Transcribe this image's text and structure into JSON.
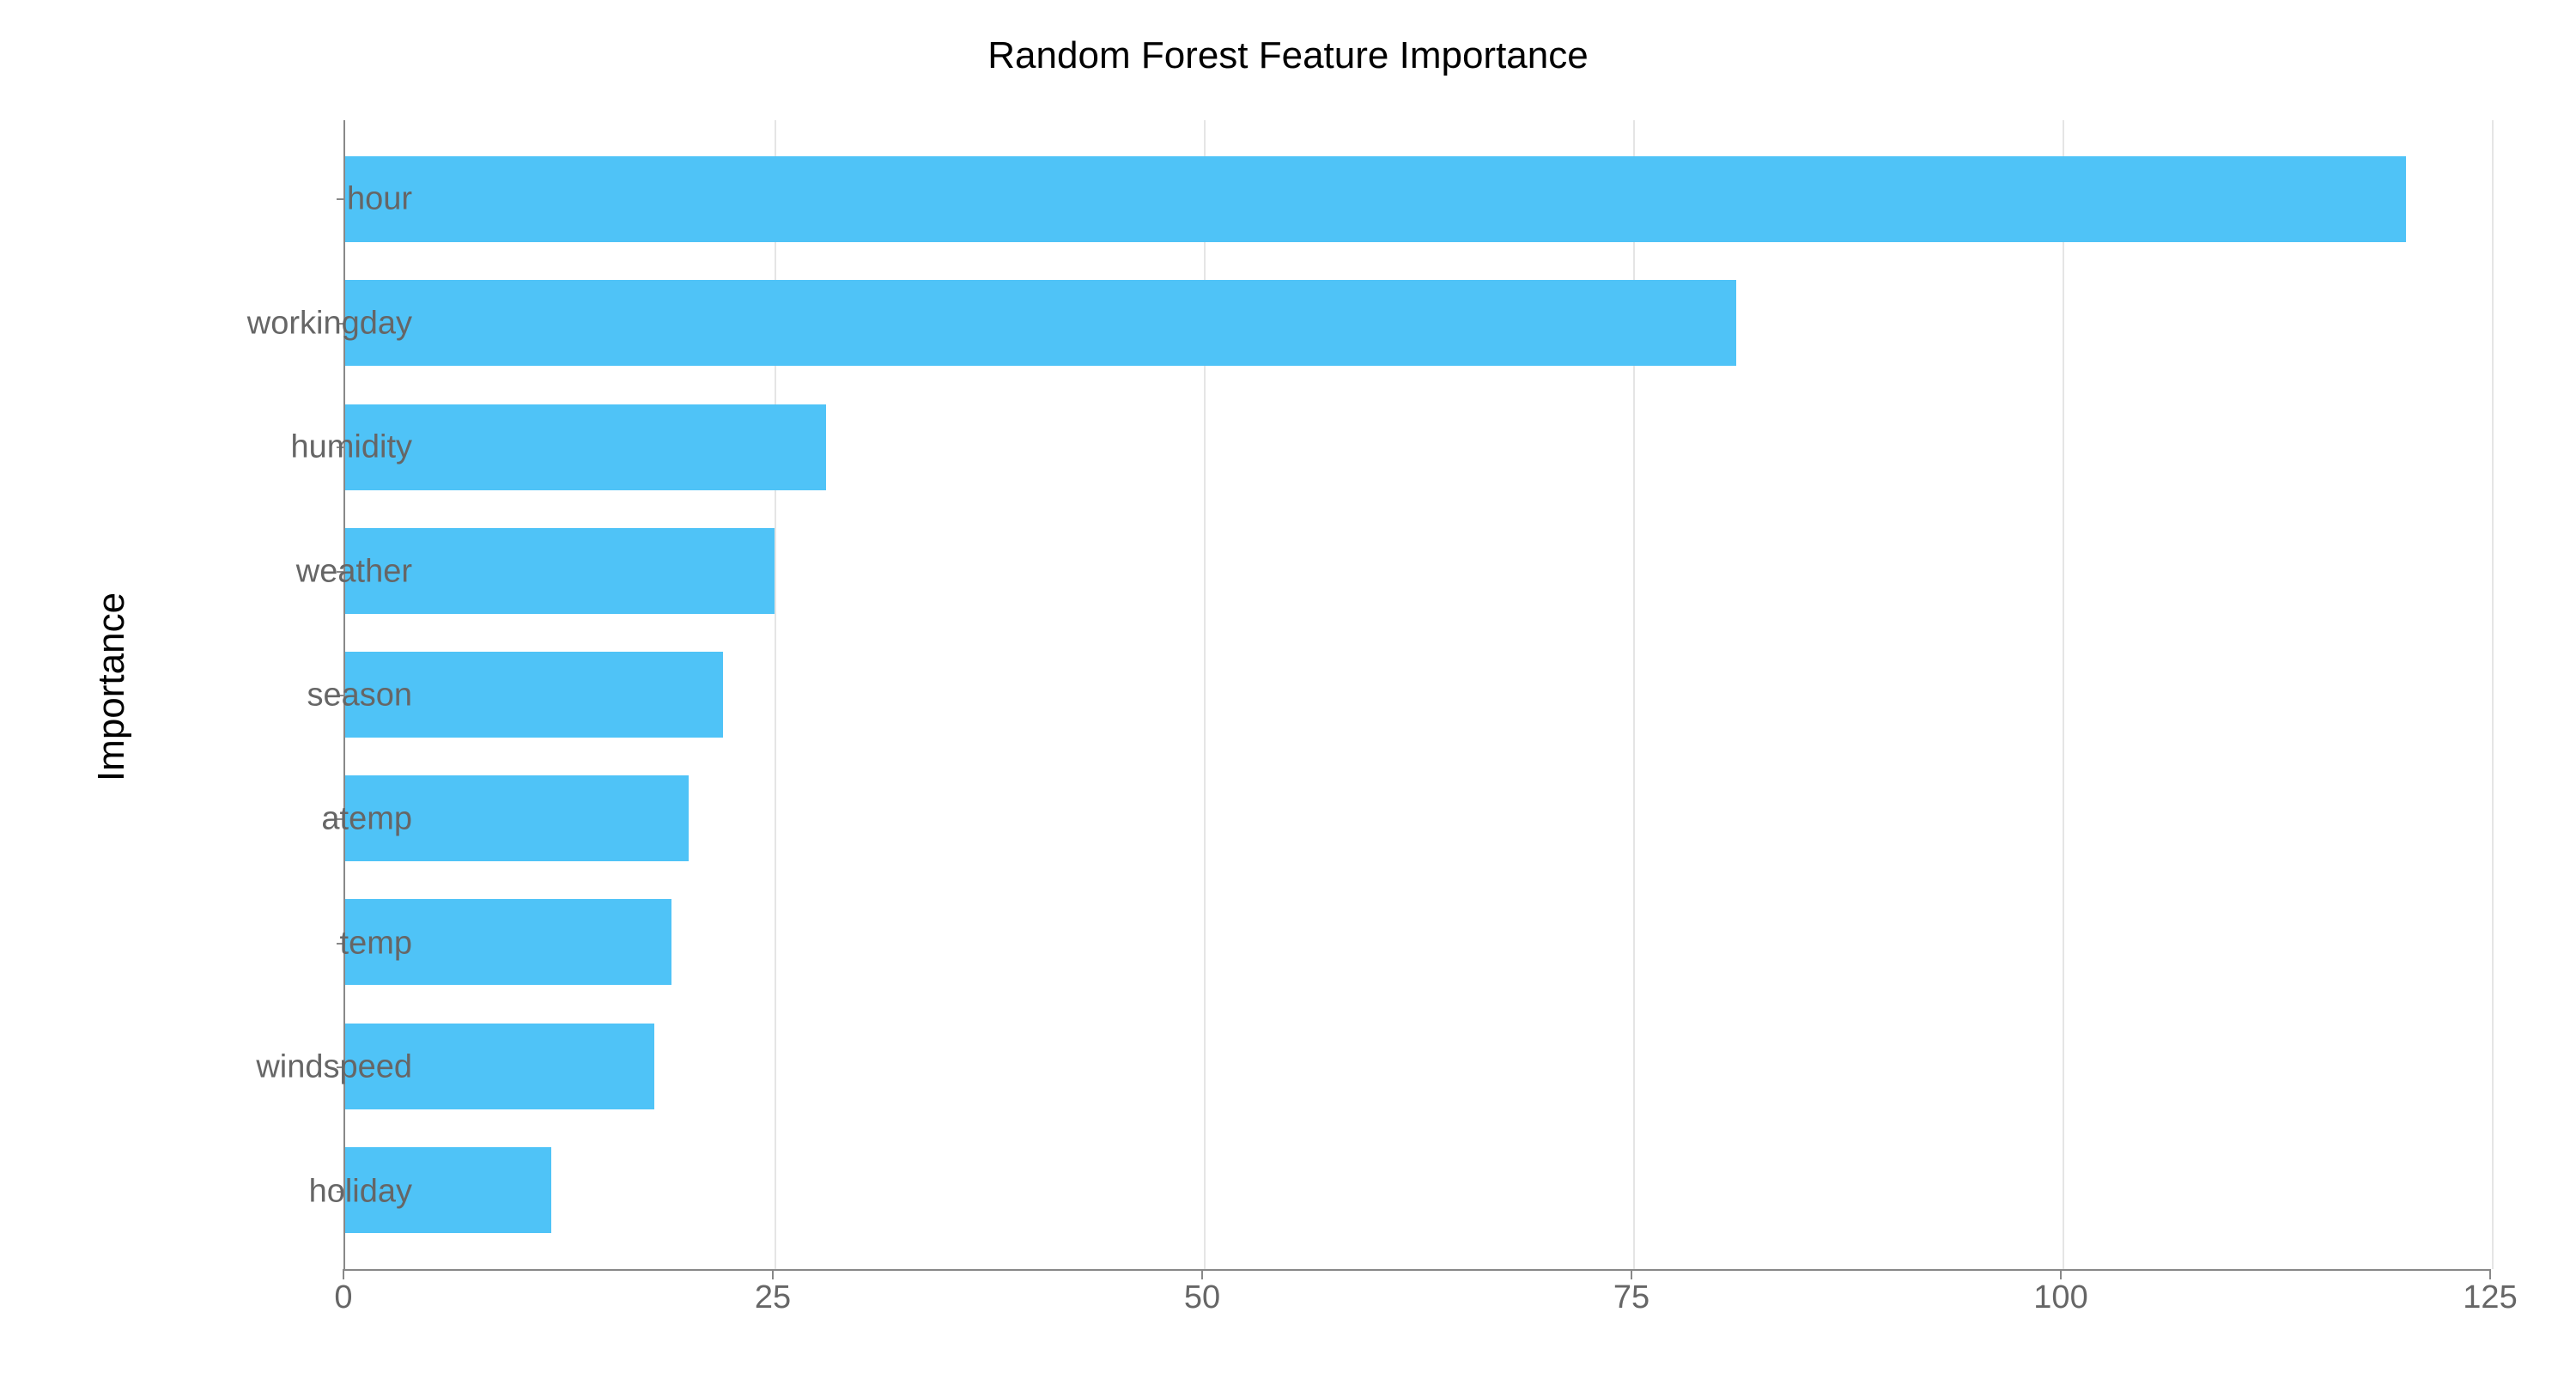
{
  "chart_data": {
    "type": "bar",
    "orientation": "horizontal",
    "title": "Random Forest Feature Importance",
    "ylabel": "Importance",
    "xlabel": "",
    "xlim": [
      0,
      125
    ],
    "xticks": [
      0,
      25,
      50,
      75,
      100,
      125
    ],
    "categories": [
      "hour",
      "workingday",
      "humidity",
      "weather",
      "season",
      "atemp",
      "temp",
      "windspeed",
      "holiday"
    ],
    "values": [
      120,
      81,
      28,
      25,
      22,
      20,
      19,
      18,
      12
    ],
    "bar_color": "#4fc3f7"
  }
}
